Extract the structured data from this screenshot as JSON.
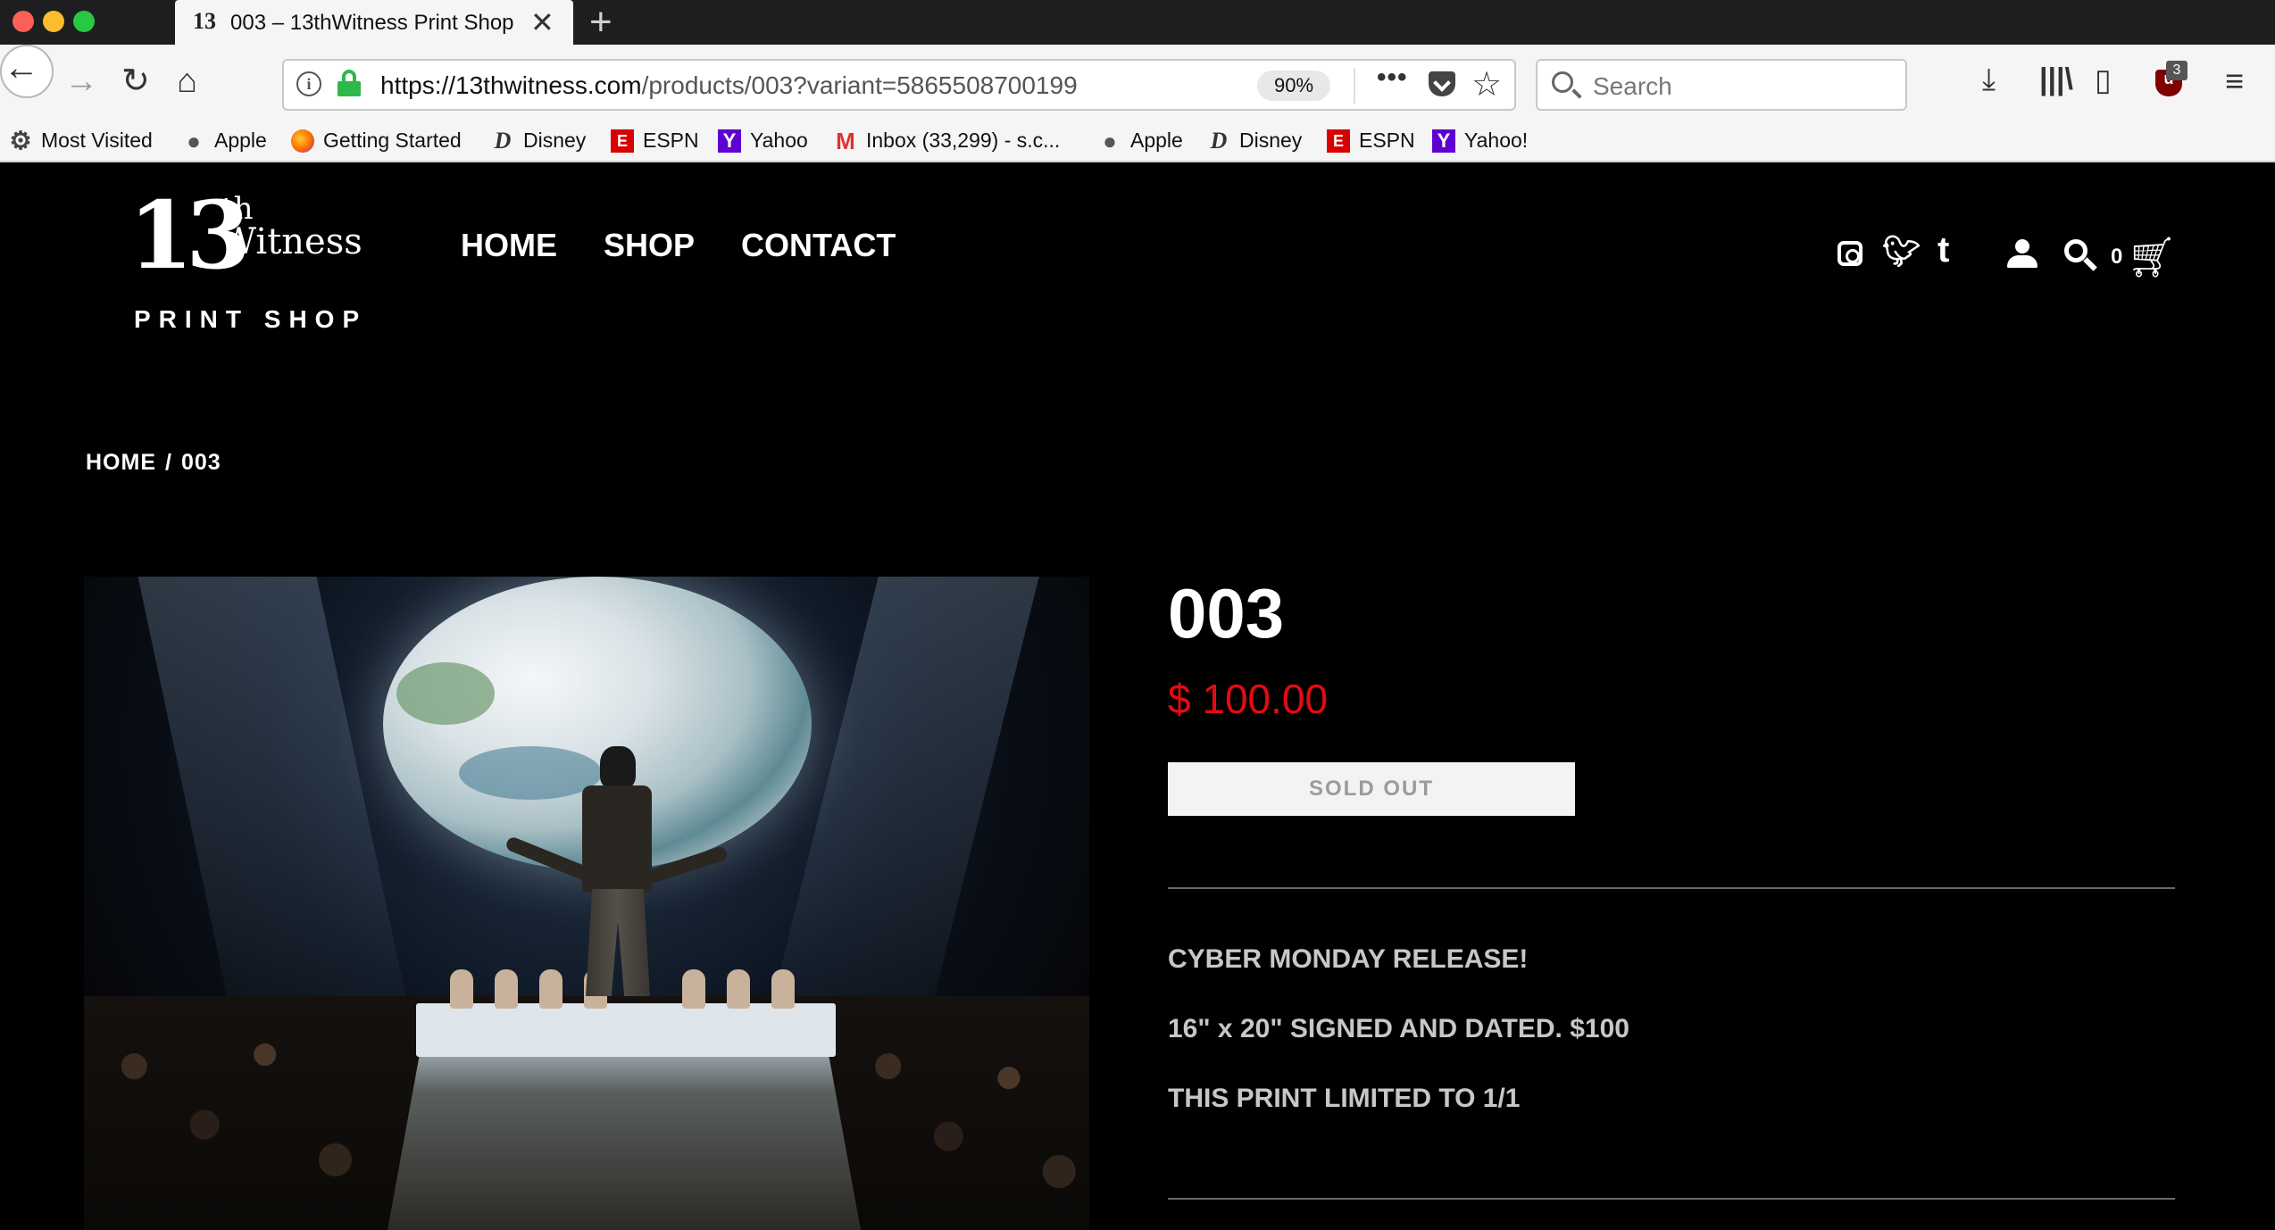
{
  "browser": {
    "tab_title": "003 – 13thWitness Print Shop",
    "tab_icon_text": "13",
    "url_domain": "https://13thwitness.com",
    "url_path": "/products/003?variant=5865508700199",
    "zoom": "90%",
    "search_placeholder": "Search",
    "ublock_count": "3",
    "bookmarks": [
      {
        "label": "Most Visited",
        "icon": "gear-icon"
      },
      {
        "label": "Apple",
        "icon": "apple-icon"
      },
      {
        "label": "Getting Started",
        "icon": "firefox-icon"
      },
      {
        "label": "Disney",
        "icon": "disney-icon"
      },
      {
        "label": "ESPN",
        "icon": "espn-icon"
      },
      {
        "label": "Yahoo",
        "icon": "yahoo-icon"
      },
      {
        "label": "Inbox (33,299) - s.c...",
        "icon": "gmail-icon"
      },
      {
        "label": "Apple",
        "icon": "apple-icon"
      },
      {
        "label": "Disney",
        "icon": "disney-icon"
      },
      {
        "label": "ESPN",
        "icon": "espn-icon"
      },
      {
        "label": "Yahoo!",
        "icon": "yahoo-icon"
      }
    ]
  },
  "site": {
    "logo": {
      "number": "13",
      "superscript": "th",
      "word": "Witness",
      "subtitle": "PRINT SHOP"
    },
    "nav": {
      "home": "HOME",
      "shop": "SHOP",
      "contact": "CONTACT"
    },
    "cart_count": "0",
    "breadcrumb": {
      "home": "HOME",
      "separator": "/",
      "current": "003"
    },
    "product": {
      "title": "003",
      "price": "$ 100.00",
      "button": "SOLD OUT",
      "description": [
        "CYBER MONDAY RELEASE!",
        "16\" x 20\" SIGNED AND DATED. $100",
        "THIS PRINT LIMITED TO 1/1"
      ]
    },
    "colors": {
      "price": "#e40b10",
      "background": "#000000"
    }
  }
}
